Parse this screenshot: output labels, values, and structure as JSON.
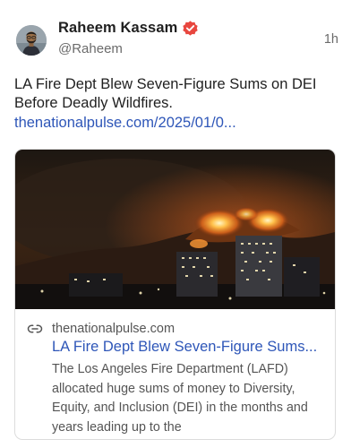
{
  "author": {
    "display_name": "Raheem Kassam",
    "handle": "@Raheem",
    "verified": true,
    "avatar_icon": "avatar"
  },
  "post": {
    "time": "1h",
    "text": "LA Fire Dept Blew Seven-Figure Sums on DEI Before Deadly Wildfires.",
    "link_text": "thenationalpulse.com/2025/01/0..."
  },
  "link_card": {
    "image_icon": "wildfire-night-photo",
    "domain_icon": "link-icon",
    "domain": "thenationalpulse.com",
    "title": "LA Fire Dept Blew Seven-Figure Sums...",
    "description": "The Los Angeles Fire Department (LAFD) allocated huge sums of money to Diversity, Equity, and Inclusion (DEI) in the months and years leading up to the"
  },
  "colors": {
    "accent_link": "#2e56b8",
    "verified_badge": "#e8473f",
    "secondary_text": "#6b6b6b"
  }
}
